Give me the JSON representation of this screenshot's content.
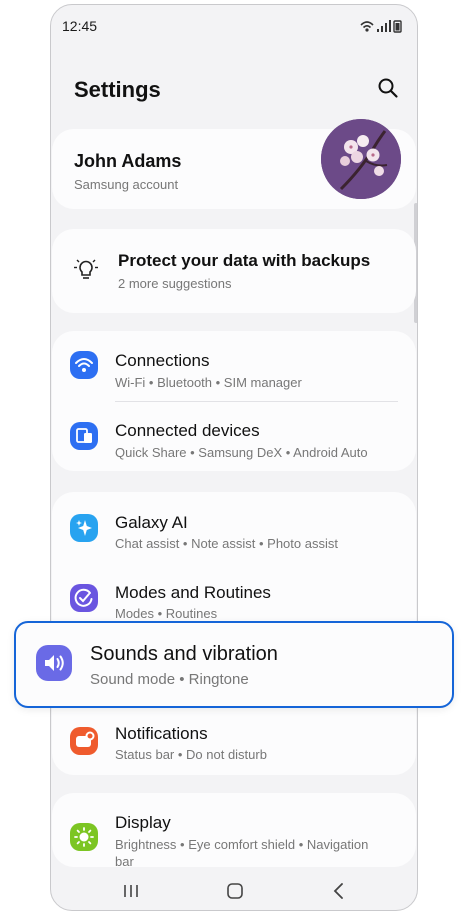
{
  "status_bar": {
    "time": "12:45"
  },
  "header": {
    "title": "Settings"
  },
  "account": {
    "name": "John Adams",
    "subtitle": "Samsung account"
  },
  "suggestion": {
    "title": "Protect your data with backups",
    "subtitle": "2 more suggestions"
  },
  "items": [
    {
      "label": "Connections",
      "subtitle": "Wi-Fi  •  Bluetooth  •  SIM manager",
      "icon": "wifi-icon",
      "color": "#2d6ff2"
    },
    {
      "label": "Connected devices",
      "subtitle": "Quick Share  •  Samsung DeX  •  Android Auto",
      "icon": "devices-icon",
      "color": "#2d6ff2"
    },
    {
      "label": "Galaxy AI",
      "subtitle": "Chat assist  •  Note assist  •  Photo assist",
      "icon": "sparkle-icon",
      "color": "#28a3f0"
    },
    {
      "label": "Modes and Routines",
      "subtitle": "Modes  •  Routines",
      "icon": "check-circle-icon",
      "color": "#6a55e0"
    },
    {
      "label": "Notifications",
      "subtitle": "Status bar  •  Do not disturb",
      "icon": "notification-icon",
      "color": "#ef5b2d"
    },
    {
      "label": "Display",
      "subtitle": "Brightness  •  Eye comfort shield  •  Navigation",
      "subtitle2": "bar",
      "icon": "sun-icon",
      "color": "#7cc523"
    }
  ],
  "highlighted_item": {
    "label": "Sounds and vibration",
    "subtitle": "Sound mode  •  Ringtone",
    "icon": "speaker-icon",
    "color": "#6a6ae6"
  },
  "highlight_color": "#1565d8"
}
